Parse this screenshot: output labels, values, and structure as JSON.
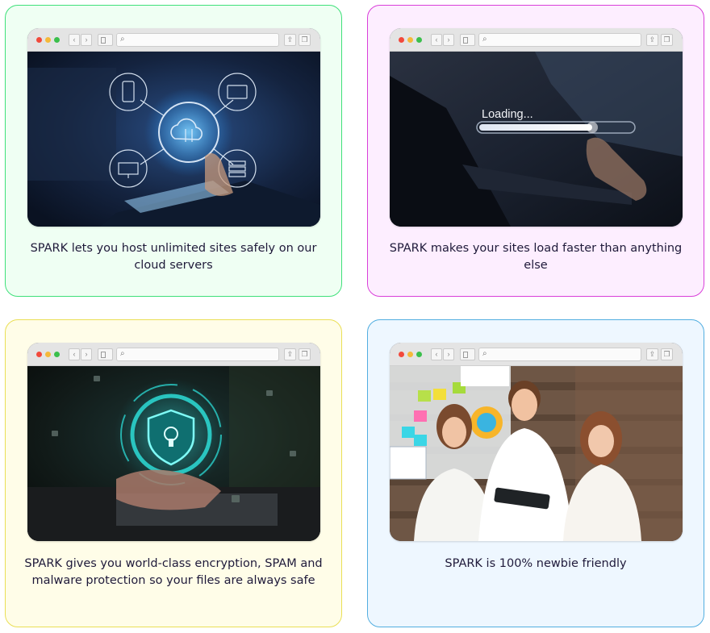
{
  "cards": [
    {
      "caption": "SPARK lets you host unlimited sites safely on our cloud servers",
      "border_color": "#3fe07a",
      "background_color": "#effff3",
      "image": "cloud-hosting-network-photo"
    },
    {
      "caption": "SPARK makes your sites load faster than anything else",
      "loading_text": "Loading...",
      "border_color": "#d93fd9",
      "background_color": "#fdeeff",
      "image": "loading-progress-bar-photo"
    },
    {
      "caption": "SPARK gives you world-class encryption, SPAM and malware protection so your files are always safe",
      "border_color": "#eadf55",
      "background_color": "#fffde8",
      "image": "security-shield-lock-photo"
    },
    {
      "caption": "SPARK is 100% newbie friendly",
      "border_color": "#52aee0",
      "background_color": "#eef7ff",
      "image": "happy-team-with-tablet-photo"
    }
  ]
}
